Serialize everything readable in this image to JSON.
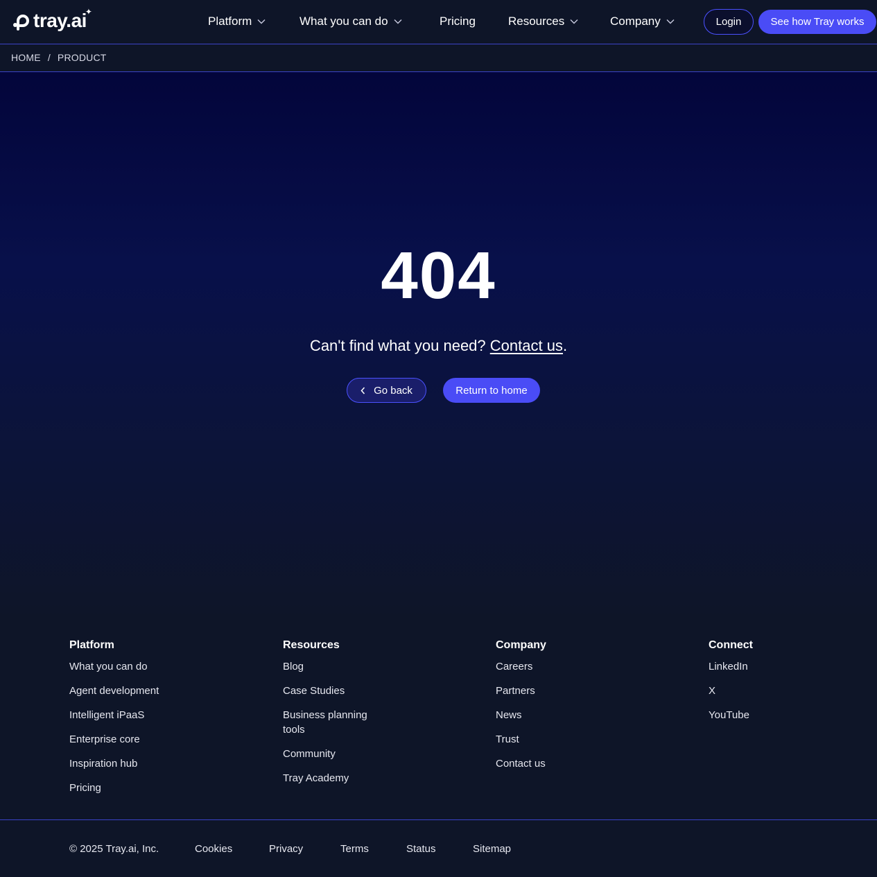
{
  "header": {
    "logo_text": "tray.ai",
    "nav": [
      {
        "label": "Platform",
        "has_dropdown": true
      },
      {
        "label": "What you can do",
        "has_dropdown": true
      },
      {
        "label": "Pricing",
        "has_dropdown": false
      },
      {
        "label": "Resources",
        "has_dropdown": true
      },
      {
        "label": "Company",
        "has_dropdown": true
      }
    ],
    "login_label": "Login",
    "cta_label": "See how Tray works"
  },
  "breadcrumb": {
    "home": "HOME",
    "separator": "/",
    "current": "PRODUCT"
  },
  "error": {
    "code": "404",
    "message_prefix": "Can't find what you need? ",
    "contact_link": "Contact us",
    "message_suffix": ".",
    "back_label": "Go back",
    "home_label": "Return to home"
  },
  "footer": {
    "columns": [
      {
        "title": "Platform",
        "links": [
          "What you can do",
          "Agent development",
          "Intelligent iPaaS",
          "Enterprise core",
          "Inspiration hub",
          "Pricing"
        ]
      },
      {
        "title": "Resources",
        "links": [
          "Blog",
          "Case Studies",
          "Business planning tools",
          "Community",
          "Tray Academy"
        ]
      },
      {
        "title": "Company",
        "links": [
          "Careers",
          "Partners",
          "News",
          "Trust",
          "Contact us"
        ]
      },
      {
        "title": "Connect",
        "links": [
          "LinkedIn",
          "X",
          "YouTube"
        ]
      }
    ],
    "legal": {
      "copyright": "© 2025 Tray.ai, Inc.",
      "links": [
        "Cookies",
        "Privacy",
        "Terms",
        "Status",
        "Sitemap"
      ]
    }
  },
  "colors": {
    "accent": "#4a4cf6",
    "background": "#0e1528",
    "hero_top": "#03053b",
    "divider": "#3b43c8"
  },
  "icons": [
    "tray-logo-icon",
    "chevron-down-icon",
    "chevron-left-icon"
  ]
}
